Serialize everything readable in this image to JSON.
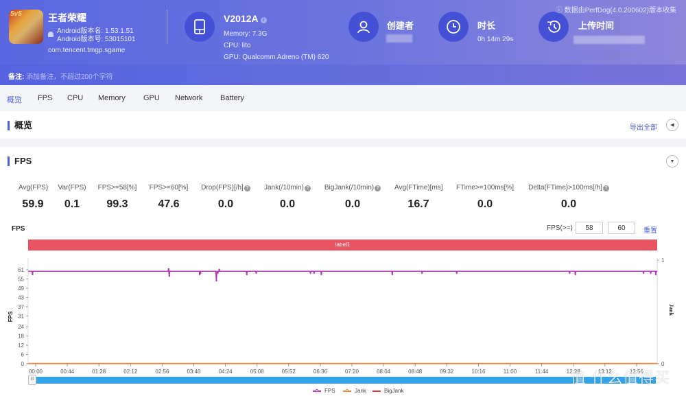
{
  "app": {
    "name": "王者荣耀",
    "icon_badge": "5v5",
    "version_name": "Android版本名: 1.53.1.51",
    "version_code": "Android版本号: 53015101",
    "package": "com.tencent.tmgp.sgame"
  },
  "device": {
    "model": "V2012A",
    "memory": "Memory: 7.3G",
    "cpu": "CPU: lito",
    "gpu": "GPU: Qualcomm Adreno (TM) 620"
  },
  "meta": {
    "creator_label": "创建者",
    "duration_label": "时长",
    "duration_value": "0h 14m 29s",
    "upload_label": "上传时间"
  },
  "source_note": "数据由PerfDog(4.0.200602)版本收集",
  "note": {
    "label": "备注:",
    "placeholder": "添加备注，不超过200个字符"
  },
  "tabs": [
    {
      "label": "概览",
      "active": true
    },
    {
      "label": "FPS"
    },
    {
      "label": "CPU"
    },
    {
      "label": "Memory"
    },
    {
      "label": "GPU"
    },
    {
      "label": "Network"
    },
    {
      "label": "Battery"
    }
  ],
  "overview": {
    "title": "概览",
    "export_label": "导出全部"
  },
  "fps_section": {
    "title": "FPS",
    "metrics": [
      {
        "label": "Avg(FPS)",
        "value": "59.9",
        "help": false
      },
      {
        "label": "Var(FPS)",
        "value": "0.1",
        "help": false
      },
      {
        "label": "FPS>=58[%]",
        "value": "99.3",
        "help": false
      },
      {
        "label": "FPS>=60[%]",
        "value": "47.6",
        "help": false
      },
      {
        "label": "Drop(FPS)[/h]",
        "value": "0.0",
        "help": true
      },
      {
        "label": "Jank(/10min)",
        "value": "0.0",
        "help": true
      },
      {
        "label": "BigJank(/10min)",
        "value": "0.0",
        "help": true
      },
      {
        "label": "Avg(FTime)[ms]",
        "value": "16.7",
        "help": false
      },
      {
        "label": "FTime>=100ms[%]",
        "value": "0.0",
        "help": false
      },
      {
        "label": "Delta(FTime)>100ms[/h]",
        "value": "0.0",
        "help": true
      }
    ],
    "chart_label": "FPS",
    "threshold_label": "FPS(>=)",
    "threshold_1": "58",
    "threshold_2": "60",
    "reset_label": "重置",
    "label_bar": "label1"
  },
  "chart_data": {
    "type": "line",
    "title": "FPS",
    "ylabel": "FPS",
    "y2label": "Jank",
    "ylim": [
      0,
      61
    ],
    "y2lim": [
      0,
      1
    ],
    "yticks": [
      0,
      6,
      12,
      18,
      24,
      31,
      37,
      43,
      49,
      55,
      61
    ],
    "y2ticks": [
      0,
      1
    ],
    "xticks": [
      "00:00",
      "00:44",
      "01:28",
      "02:12",
      "02:56",
      "03:40",
      "04:24",
      "05:08",
      "05:52",
      "06:36",
      "07:20",
      "08:04",
      "08:48",
      "09:32",
      "10:16",
      "11:00",
      "11:44",
      "12:28",
      "13:12",
      "13:56"
    ],
    "x_range_seconds": [
      0,
      869
    ],
    "grid": false,
    "legend": "bottom-center",
    "series": [
      {
        "name": "FPS",
        "color": "#b43bb8",
        "baseline": 60,
        "dips": [
          {
            "t": 6,
            "v": 58
          },
          {
            "t": 194,
            "v": 61.5
          },
          {
            "t": 195,
            "v": 57
          },
          {
            "t": 237,
            "v": 58
          },
          {
            "t": 238,
            "v": 59
          },
          {
            "t": 260,
            "v": 54
          },
          {
            "t": 264,
            "v": 61
          },
          {
            "t": 262,
            "v": 59
          },
          {
            "t": 302,
            "v": 58
          },
          {
            "t": 315,
            "v": 59
          },
          {
            "t": 390,
            "v": 59
          },
          {
            "t": 395,
            "v": 59
          },
          {
            "t": 405,
            "v": 58
          },
          {
            "t": 503,
            "v": 58
          },
          {
            "t": 544,
            "v": 59
          },
          {
            "t": 592,
            "v": 59
          },
          {
            "t": 748,
            "v": 59
          },
          {
            "t": 756,
            "v": 58
          },
          {
            "t": 850,
            "v": 59
          },
          {
            "t": 860,
            "v": 59
          },
          {
            "t": 867,
            "v": 58
          }
        ]
      },
      {
        "name": "Jank",
        "color": "#f0883a",
        "values_constant": 0
      },
      {
        "name": "BigJank",
        "color": "#e03a3a",
        "values_constant": 0
      }
    ]
  },
  "watermark": "值 什么值得买"
}
